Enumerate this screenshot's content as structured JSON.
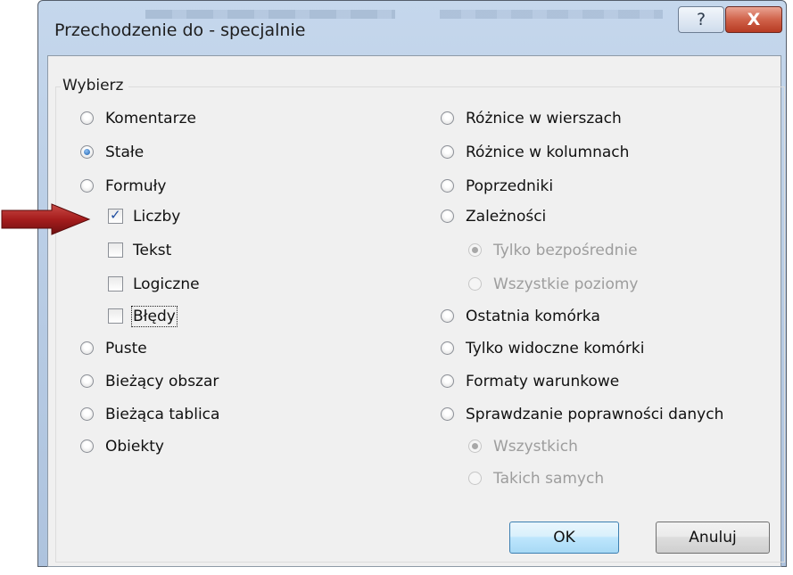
{
  "window": {
    "title": "Przechodzenie do - specjalnie",
    "help_label": "?",
    "close_label": "X"
  },
  "group": {
    "label": "Wybierz"
  },
  "left_options": [
    {
      "label": "Komentarze",
      "selected": false
    },
    {
      "label": "Stałe",
      "selected": true
    },
    {
      "label": "Formuły",
      "selected": false
    }
  ],
  "checkboxes": [
    {
      "label": "Liczby",
      "checked": true
    },
    {
      "label": "Tekst",
      "checked": false
    },
    {
      "label": "Logiczne",
      "checked": false
    },
    {
      "label": "Błędy",
      "checked": false
    }
  ],
  "left_options_lower": [
    {
      "label": "Puste",
      "selected": false
    },
    {
      "label": "Bieżący obszar",
      "selected": false
    },
    {
      "label": "Bieżąca tablica",
      "selected": false
    },
    {
      "label": "Obiekty",
      "selected": false
    }
  ],
  "right_options": [
    {
      "label": "Różnice w wierszach",
      "selected": false
    },
    {
      "label": "Różnice w kolumnach",
      "selected": false
    },
    {
      "label": "Poprzedniki",
      "selected": false
    },
    {
      "label": "Zależności",
      "selected": false
    }
  ],
  "dependency_suboptions": [
    {
      "label": "Tylko bezpośrednie",
      "selected": true,
      "disabled": true
    },
    {
      "label": "Wszystkie poziomy",
      "selected": false,
      "disabled": true
    }
  ],
  "right_options_lower": [
    {
      "label": "Ostatnia komórka",
      "selected": false
    },
    {
      "label": "Tylko widoczne komórki",
      "selected": false
    },
    {
      "label": "Formaty warunkowe",
      "selected": false
    },
    {
      "label": "Sprawdzanie poprawności danych",
      "selected": false
    }
  ],
  "validation_suboptions": [
    {
      "label": "Wszystkich",
      "selected": true,
      "disabled": true
    },
    {
      "label": "Takich samych",
      "selected": false,
      "disabled": true
    }
  ],
  "buttons": {
    "ok": "OK",
    "cancel": "Anuluj"
  },
  "colors": {
    "arrow": "#a61d1d",
    "title_bar": "#b6cae3",
    "close_button": "#c44a32",
    "radio_selected": "#1d5ea9"
  },
  "icons": {
    "arrow": "right-arrow-icon",
    "radio": "radio-icon",
    "checkbox": "checkbox-icon",
    "check": "checkmark-icon"
  }
}
